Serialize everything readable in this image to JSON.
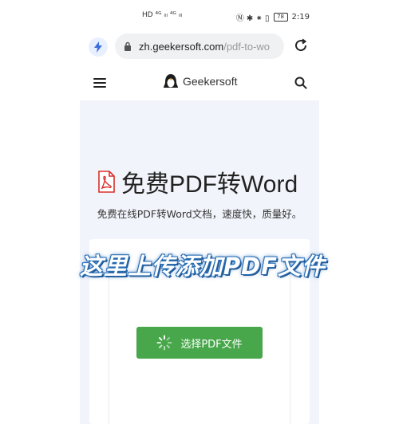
{
  "status_bar": {
    "left_indicators": "HD ⁴ᴳ ᵢₗₗ ⁴ᴳ ᵢₗₗ",
    "right_icons": "Ⓝ ✱ ⁕ ▯",
    "battery": "78",
    "time": "2:19"
  },
  "browser": {
    "url_domain": "zh.geekersoft.com",
    "url_path": "/pdf-to-wo"
  },
  "header": {
    "logo_text": "Geekersoft"
  },
  "hero": {
    "title": "免费PDF转Word",
    "subtitle": "免费在线PDF转Word文档，速度快，质量好。"
  },
  "upload": {
    "button_label": "选择PDF文件"
  },
  "overlay": {
    "caption": "这里上传添加PDF文件"
  },
  "colors": {
    "upload_button": "#47a74a",
    "panel_bg": "#f1f4fa",
    "caption_outline": "#2b6fb5"
  }
}
